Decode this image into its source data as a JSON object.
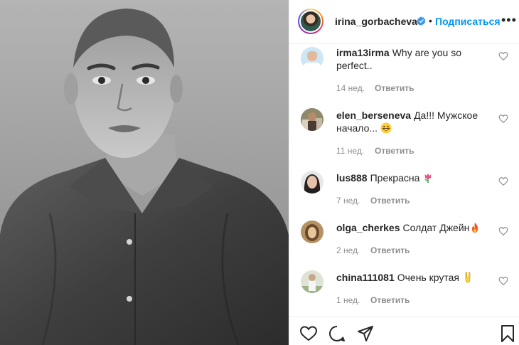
{
  "post": {
    "username": "irina_gorbacheva",
    "follow_label": "Подписаться",
    "dot": "•",
    "more_label": "•••"
  },
  "comments": [
    {
      "user": "irma13irma",
      "text": "Why are you so perfect..",
      "time": "14 нед.",
      "reply": "Ответить",
      "emoji": ""
    },
    {
      "user": "elen_berseneva",
      "text": "Да!!! Мужское начало...",
      "time": "11 нед.",
      "reply": "Ответить",
      "emoji": "grin"
    },
    {
      "user": "lus888",
      "text": "Прекрасна",
      "time": "7 нед.",
      "reply": "Ответить",
      "emoji": "tulip"
    },
    {
      "user": "olga_cherkes",
      "text": "Солдат Джейн",
      "time": "2 нед.",
      "reply": "Ответить",
      "emoji": "fire"
    },
    {
      "user": "china111081",
      "text": "Очень крутая",
      "time": "1 нед.",
      "reply": "Ответить",
      "emoji": "rock-hand"
    }
  ],
  "icons": {
    "verified_color": "#3897f0",
    "accent": "#0095f6",
    "actions": [
      "heart-icon",
      "comment-icon",
      "share-icon",
      "bookmark-icon"
    ]
  }
}
